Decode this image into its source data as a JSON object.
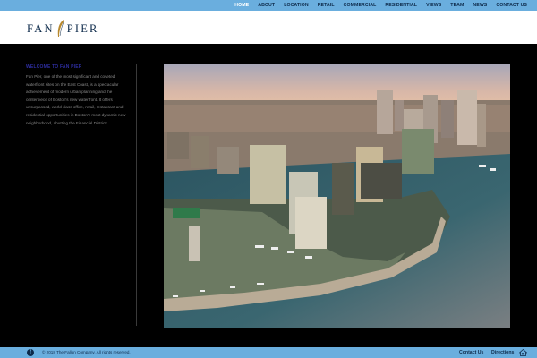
{
  "nav": {
    "items": [
      {
        "label": "HOME",
        "active": true
      },
      {
        "label": "ABOUT"
      },
      {
        "label": "LOCATION"
      },
      {
        "label": "RETAIL"
      },
      {
        "label": "COMMERCIAL"
      },
      {
        "label": "RESIDENTIAL"
      },
      {
        "label": "VIEWS"
      },
      {
        "label": "TEAM"
      },
      {
        "label": "NEWS"
      },
      {
        "label": "CONTACT US"
      }
    ]
  },
  "logo": {
    "left": "FAN",
    "right": "PIER",
    "icon": "feather-icon"
  },
  "intro": {
    "title": "WELCOME TO FAN PIER",
    "body": "Fan Pier, one of the most significant and coveted waterfront sites on the East Coast, is a spectacular achievement of modern urban planning and the centerpiece of Boston's new waterfront. It offers unsurpassed, world class office, retail, restaurant and residential opportunities in Boston's most dynamic new neighborhood, abutting the Financial District."
  },
  "hero": {
    "icon": "aerial-photo"
  },
  "footer": {
    "social_icon": "facebook-icon",
    "copyright": "© 2018 The Fallon Company.  All rights reserved.",
    "contact_label": "Contact Us",
    "directions_label": "Directions",
    "home_icon": "equal-housing-icon"
  },
  "colors": {
    "nav_bg": "#6aaede",
    "nav_text": "#0d2a4a",
    "active": "#ffffff",
    "page_bg": "#000000"
  }
}
